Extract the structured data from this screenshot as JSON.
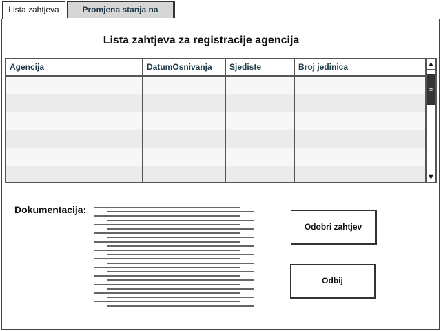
{
  "tabs": [
    {
      "label": "Lista zahtjeva"
    },
    {
      "label": "Promjena stanja na racunu"
    }
  ],
  "main": {
    "title": "Lista zahtjeva za registracije agencija"
  },
  "table": {
    "columns": [
      "Agencija",
      "DatumOsnivanja",
      "Sjediste",
      "Broj jedinica"
    ],
    "scroll_up_glyph": "▲",
    "scroll_down_glyph": "▼",
    "scroll_thumb_glyph": "≡"
  },
  "documentation": {
    "label": "Dokumentacija:"
  },
  "buttons": {
    "approve": "Odobri zahtjev",
    "reject": "Odbij"
  }
}
